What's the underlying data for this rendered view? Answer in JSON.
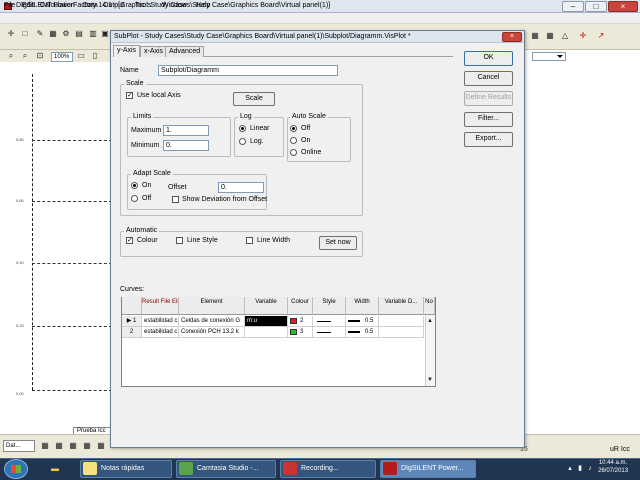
{
  "app": {
    "title": "DIgSILENT PowerFactory 14.1 - [Graphic : Study Cases\\Study Case\\Graphics Board\\Virtual panel(1)]",
    "menu": [
      "File",
      "Edit",
      "Calculation",
      "Data",
      "Output",
      "Tools",
      "Window",
      "Help"
    ],
    "zoom": "100%",
    "y_ticks": [
      "0,80",
      "0,60",
      "0,40",
      "0,20",
      "0,00"
    ],
    "bottom_tab": "Dat...",
    "sheet_tab": "Prueba Icc",
    "status_mid": "15",
    "status_right": "uR Icc"
  },
  "dialog": {
    "title": "SubPlot - Study Cases\\Study Case\\Graphics Board\\Virtual panel(1)\\Subplot/Diagramm.VisPlot *",
    "close": "×",
    "tabs": [
      "y-Axis",
      "x-Axis",
      "Advanced"
    ],
    "name_label": "Name",
    "name_value": "Subplot/Diagramm",
    "scale_group": "Scale",
    "use_local_axis": "Use local Axis",
    "scale_button": "Scale",
    "limits_group": "Limits",
    "maximum_label": "Maximum",
    "maximum_value": "1.",
    "minimum_label": "Minimum",
    "minimum_value": "0.",
    "log_group": "Log",
    "log_linear": "Linear",
    "log_log": "Log.",
    "autoscale_group": "Auto Scale",
    "autoscale_off": "Off",
    "autoscale_on": "On",
    "autoscale_online": "Online",
    "adapt_group": "Adapt Scale",
    "adapt_on": "On",
    "adapt_off": "Off",
    "offset_label": "Offset",
    "offset_value": "0.",
    "show_deviation": "Show Deviation from Offset",
    "automatic_group": "Automatic",
    "auto_colour": "Colour",
    "auto_line_style": "Line Style",
    "auto_line_width": "Line Width",
    "set_now": "Set now",
    "curves_label": "Curves:",
    "buttons": [
      "OK",
      "Cancel",
      "Define Results",
      "Filter...",
      "Export..."
    ],
    "grid": {
      "headers": [
        "Result File ElmRes,I",
        "Element",
        "Variable",
        "Colour",
        "Style",
        "Width",
        "Variable D...",
        "No"
      ],
      "rows": [
        {
          "num": "1",
          "result": "estabilidad c",
          "element": "Celdas de conexión G",
          "variable": "m:u",
          "colour_text": "2",
          "colour_hex": "#e02020",
          "width": "0.5"
        },
        {
          "num": "2",
          "result": "estabilidad c",
          "element": "Conexión PCH 13.2 k",
          "variable": "",
          "colour_text": "3",
          "colour_hex": "#20c020",
          "width": "0.5"
        }
      ]
    }
  },
  "taskbar": {
    "items": [
      "Notas rápidas",
      "Camtasia Studio -...",
      "Recording...",
      "DIgSILENT Power..."
    ],
    "time": "10:44 a.m.",
    "date": "26/07/2013"
  }
}
